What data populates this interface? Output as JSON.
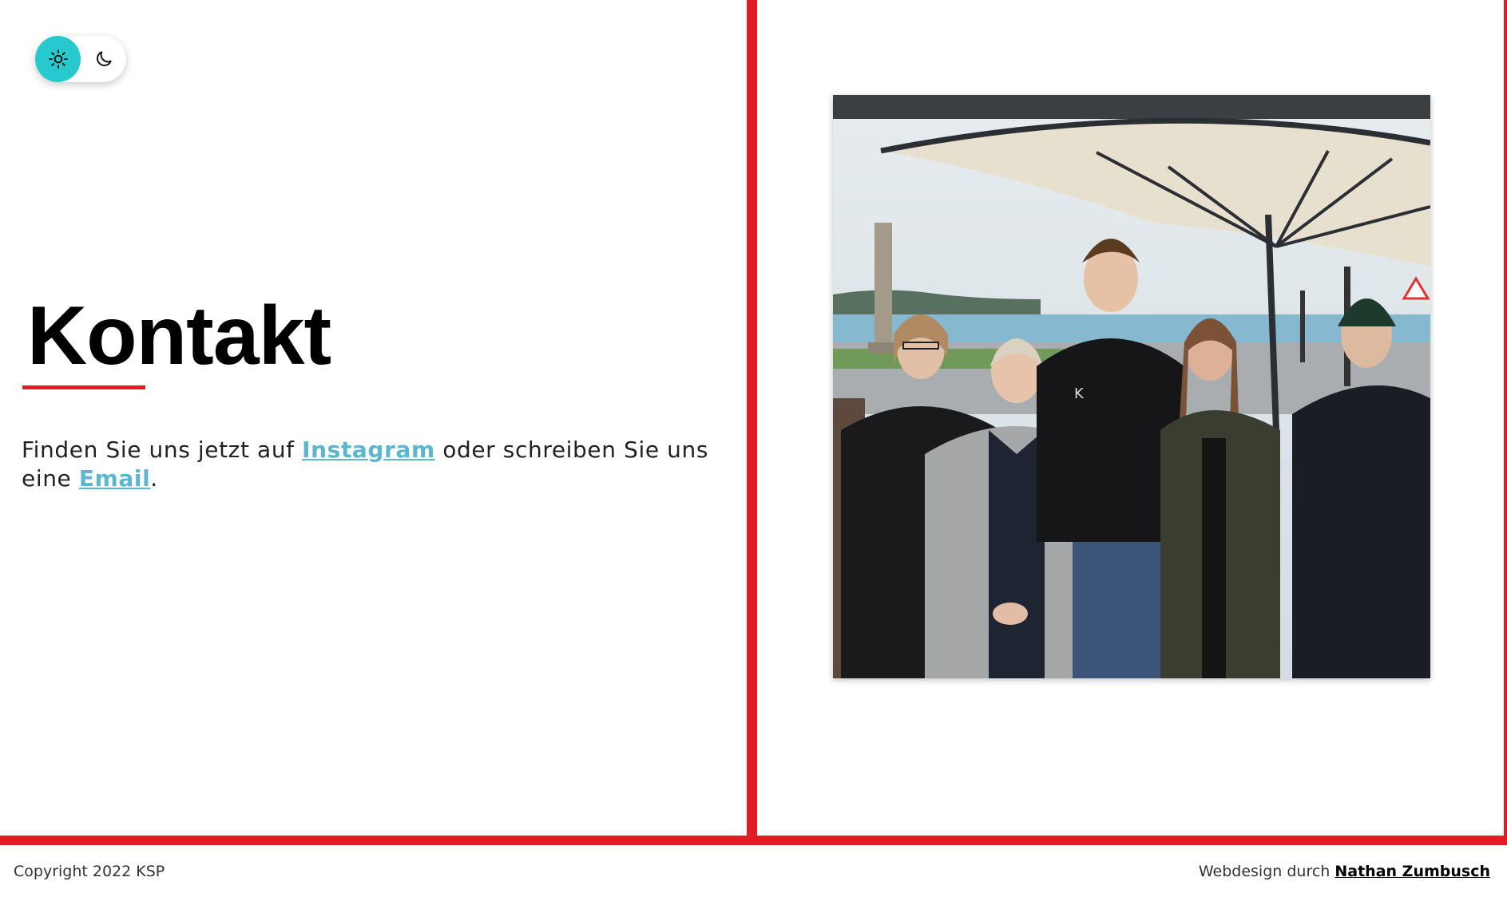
{
  "theme_toggle": {
    "options": [
      {
        "icon": "sun-icon",
        "active": true
      },
      {
        "icon": "moon-icon",
        "active": false
      }
    ],
    "active_color": "#27c9cf"
  },
  "colors": {
    "accent_red": "#e31b23",
    "link_blue": "#5cb6cf"
  },
  "contact": {
    "title": "Kontakt",
    "text_before": "Finden Sie uns jetzt auf ",
    "instagram_label": "Instagram",
    "text_middle": " oder schreiben Sie uns eine ",
    "email_label": "Email",
    "text_after": "."
  },
  "photo": {
    "icon": "group-photo-image"
  },
  "footer": {
    "copyright": "Copyright 2022 KSP",
    "credit_prefix": "Webdesign durch ",
    "credit_name": "Nathan Zumbusch"
  }
}
